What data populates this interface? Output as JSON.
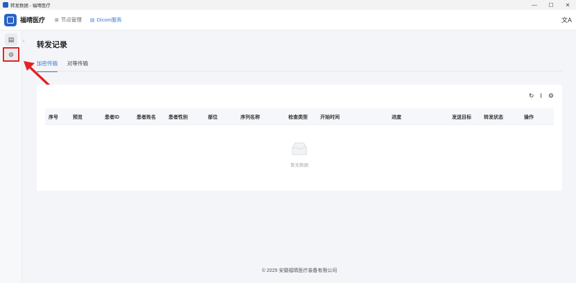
{
  "window": {
    "title": "转发数据 - 福晴医疗",
    "controls": [
      "—",
      "☐",
      "✕"
    ]
  },
  "topnav": {
    "brand": "福晴医疗",
    "items": [
      {
        "label": "节点管理",
        "icon": "grid-icon",
        "active": false
      },
      {
        "label": "Dicom服务",
        "icon": "document-icon",
        "active": true
      }
    ],
    "translate_icon": "文A"
  },
  "sidebar": {
    "items": [
      {
        "icon": "list-icon",
        "glyph": "▤"
      },
      {
        "icon": "gear-icon",
        "glyph": "⚙"
      }
    ],
    "collapse_glyph": "›"
  },
  "page": {
    "title": "转发记录",
    "tabs": [
      {
        "label": "加密传输",
        "active": true
      },
      {
        "label": "对等传输",
        "active": false
      }
    ]
  },
  "toolbar": {
    "refresh_glyph": "↻",
    "column_height_glyph": "Ι",
    "settings_glyph": "⚙"
  },
  "table": {
    "columns": [
      "序号",
      "预览",
      "患者ID",
      "患者姓名",
      "患者性别",
      "部位",
      "序列名称",
      "检查类型",
      "开始时间",
      "进度",
      "发送目标",
      "转发状态",
      "操作"
    ],
    "rows": [],
    "empty_text": "暂无数据"
  },
  "footer": {
    "text": "© 2025 安徽福晴医疗装备有限公司"
  },
  "colors": {
    "accent": "#3a7bd5",
    "highlight": "#e02424"
  }
}
